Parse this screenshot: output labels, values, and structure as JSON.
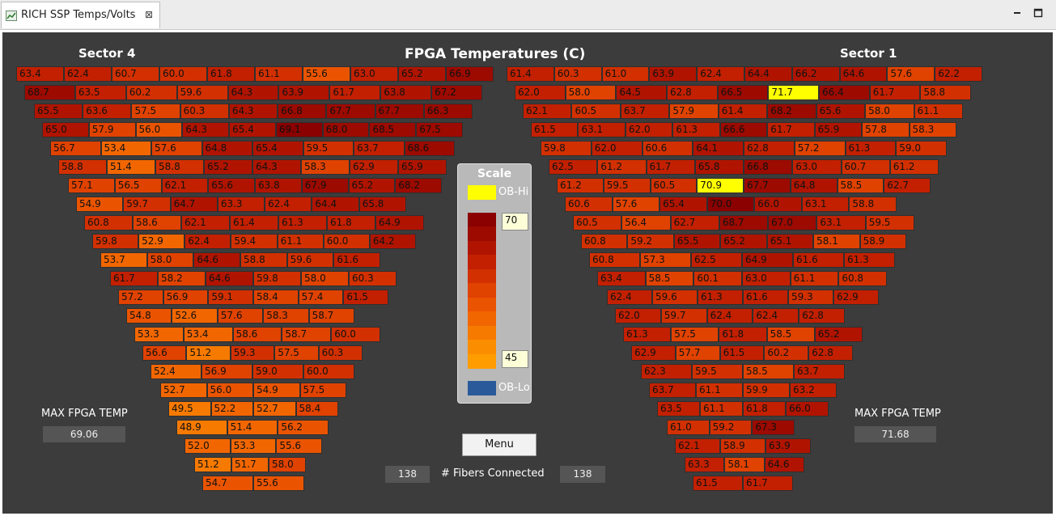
{
  "tab": {
    "label": "RICH SSP Temps/Volts",
    "close": "⊠"
  },
  "title": "FPGA Temperatures (C)",
  "sector_left": {
    "name": "Sector 4",
    "max_label": "MAX FPGA TEMP",
    "max_value": "69.06",
    "rows": [
      [
        "63.4",
        "62.4",
        "60.7",
        "60.0",
        "61.8",
        "61.1",
        "55.6",
        "63.0",
        "65.2",
        "66.9"
      ],
      [
        "68.7",
        "63.5",
        "60.2",
        "59.6",
        "64.3",
        "63.9",
        "61.7",
        "63.8",
        "67.2"
      ],
      [
        "65.5",
        "63.6",
        "57.5",
        "60.3",
        "64.3",
        "66.8",
        "67.7",
        "67.7",
        "66.3"
      ],
      [
        "65.0",
        "57.9",
        "56.0",
        "64.3",
        "65.4",
        "69.1",
        "68.0",
        "68.5",
        "67.5"
      ],
      [
        "56.7",
        "53.4",
        "57.6",
        "64.8",
        "65.4",
        "59.5",
        "63.7",
        "68.6"
      ],
      [
        "58.8",
        "51.4",
        "58.8",
        "65.2",
        "64.3",
        "58.3",
        "62.9",
        "65.9"
      ],
      [
        "57.1",
        "56.5",
        "62.1",
        "65.6",
        "63.8",
        "67.9",
        "65.2",
        "68.2"
      ],
      [
        "54.9",
        "59.7",
        "64.7",
        "63.3",
        "62.4",
        "64.4",
        "65.8"
      ],
      [
        "60.8",
        "58.6",
        "62.1",
        "61.4",
        "61.3",
        "61.8",
        "64.9"
      ],
      [
        "59.8",
        "52.9",
        "62.4",
        "59.4",
        "61.1",
        "60.0",
        "64.2"
      ],
      [
        "53.7",
        "58.0",
        "64.6",
        "58.8",
        "59.6",
        "61.6"
      ],
      [
        "61.7",
        "58.2",
        "64.6",
        "59.8",
        "58.0",
        "60.3"
      ],
      [
        "57.2",
        "56.9",
        "59.1",
        "58.4",
        "57.4",
        "61.5"
      ],
      [
        "54.8",
        "52.6",
        "57.6",
        "58.3",
        "58.7"
      ],
      [
        "53.3",
        "53.4",
        "58.6",
        "58.7",
        "60.0"
      ],
      [
        "56.6",
        "51.2",
        "59.3",
        "57.5",
        "60.3"
      ],
      [
        "52.4",
        "56.9",
        "59.0",
        "60.0"
      ],
      [
        "52.7",
        "56.0",
        "54.9",
        "57.5"
      ],
      [
        "49.5",
        "52.2",
        "52.7",
        "58.4"
      ],
      [
        "48.9",
        "51.4",
        "56.2"
      ],
      [
        "52.0",
        "53.3",
        "55.6"
      ],
      [
        "51.2",
        "51.7",
        "58.0"
      ],
      [
        "54.7",
        "55.6"
      ]
    ]
  },
  "sector_right": {
    "name": "Sector 1",
    "max_label": "MAX FPGA TEMP",
    "max_value": "71.68",
    "rows": [
      [
        "61.4",
        "60.3",
        "61.0",
        "63.9",
        "62.4",
        "64.4",
        "66.2",
        "64.6",
        "57.6",
        "62.2"
      ],
      [
        "62.0",
        "58.0",
        "64.5",
        "62.8",
        "66.5",
        "71.7",
        "66.4",
        "61.7",
        "58.8"
      ],
      [
        "62.1",
        "60.5",
        "63.7",
        "57.9",
        "61.4",
        "68.2",
        "65.6",
        "58.0",
        "61.1"
      ],
      [
        "61.5",
        "63.1",
        "62.0",
        "61.3",
        "66.6",
        "61.7",
        "65.9",
        "57.8",
        "58.3"
      ],
      [
        "59.8",
        "62.0",
        "60.6",
        "64.1",
        "62.8",
        "57.2",
        "61.3",
        "59.0"
      ],
      [
        "62.5",
        "61.2",
        "61.7",
        "65.8",
        "66.8",
        "63.0",
        "60.7",
        "61.2"
      ],
      [
        "61.2",
        "59.5",
        "60.5",
        "70.9",
        "67.7",
        "64.8",
        "58.5",
        "62.7"
      ],
      [
        "60.6",
        "57.6",
        "65.4",
        "70.0",
        "66.0",
        "63.1",
        "58.8"
      ],
      [
        "60.5",
        "56.4",
        "62.7",
        "68.7",
        "67.0",
        "63.1",
        "59.5"
      ],
      [
        "60.8",
        "59.2",
        "65.5",
        "65.2",
        "65.1",
        "58.1",
        "58.9"
      ],
      [
        "60.8",
        "57.3",
        "62.5",
        "64.9",
        "61.6",
        "61.3"
      ],
      [
        "63.4",
        "58.5",
        "60.1",
        "63.0",
        "61.1",
        "60.8"
      ],
      [
        "62.4",
        "59.6",
        "61.3",
        "61.6",
        "59.3",
        "62.9"
      ],
      [
        "62.0",
        "59.7",
        "62.4",
        "62.4",
        "62.8"
      ],
      [
        "61.3",
        "57.5",
        "61.8",
        "58.5",
        "65.2"
      ],
      [
        "62.9",
        "57.7",
        "61.5",
        "60.2",
        "62.8"
      ],
      [
        "62.3",
        "59.5",
        "58.5",
        "63.7"
      ],
      [
        "63.7",
        "61.1",
        "59.9",
        "63.2"
      ],
      [
        "63.5",
        "61.1",
        "61.8",
        "66.0"
      ],
      [
        "61.0",
        "59.2",
        "67.3"
      ],
      [
        "62.1",
        "58.9",
        "63.9"
      ],
      [
        "63.3",
        "58.1",
        "64.6"
      ],
      [
        "61.5",
        "61.7"
      ]
    ]
  },
  "scale": {
    "title": "Scale",
    "ob_hi_label": "OB-Hi",
    "ob_lo_label": "OB-Lo",
    "max_value": "70",
    "min_value": "45",
    "ob_hi_color": "#ffff00",
    "ob_lo_color": "#2a5a9a",
    "gradient": [
      "#8b0000",
      "#9c0a00",
      "#b01400",
      "#c22000",
      "#d23000",
      "#e04200",
      "#ea5400",
      "#f26600",
      "#f77a00",
      "#fb8e00",
      "#ff9c00"
    ]
  },
  "menu_label": "Menu",
  "fibers": {
    "left": "138",
    "label": "# Fibers Connected",
    "right": "138"
  }
}
